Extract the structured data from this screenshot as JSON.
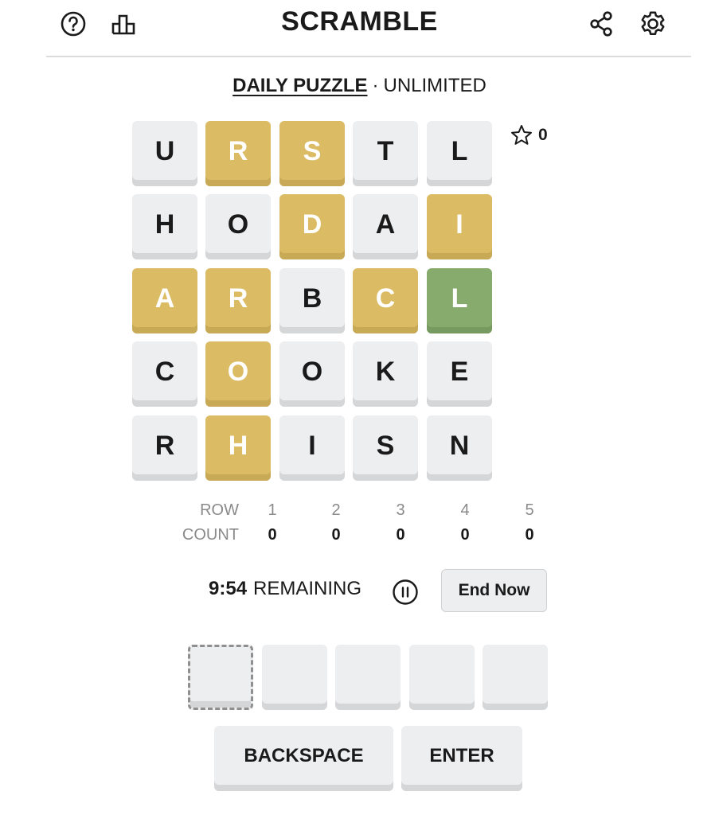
{
  "header": {
    "title": "SCRAMBLE",
    "icons": [
      "help-icon",
      "stats-icon",
      "share-icon",
      "settings-icon"
    ]
  },
  "mode": {
    "active": "DAILY PUZZLE",
    "separator": "·",
    "inactive": "UNLIMITED"
  },
  "score": {
    "icon": "star-icon",
    "value": "0"
  },
  "colors": {
    "gray": "#edeef0",
    "yellow": "#dbbb64",
    "green": "#86ab6d",
    "text": "#1a1a1a"
  },
  "grid": [
    [
      {
        "l": "U",
        "s": "gray"
      },
      {
        "l": "R",
        "s": "yellow"
      },
      {
        "l": "S",
        "s": "yellow"
      },
      {
        "l": "T",
        "s": "gray"
      },
      {
        "l": "L",
        "s": "gray"
      }
    ],
    [
      {
        "l": "H",
        "s": "gray"
      },
      {
        "l": "O",
        "s": "gray"
      },
      {
        "l": "D",
        "s": "yellow"
      },
      {
        "l": "A",
        "s": "gray"
      },
      {
        "l": "I",
        "s": "yellow"
      }
    ],
    [
      {
        "l": "A",
        "s": "yellow"
      },
      {
        "l": "R",
        "s": "yellow"
      },
      {
        "l": "B",
        "s": "gray"
      },
      {
        "l": "C",
        "s": "yellow"
      },
      {
        "l": "L",
        "s": "green"
      }
    ],
    [
      {
        "l": "C",
        "s": "gray"
      },
      {
        "l": "O",
        "s": "yellow"
      },
      {
        "l": "O",
        "s": "gray"
      },
      {
        "l": "K",
        "s": "gray"
      },
      {
        "l": "E",
        "s": "gray"
      }
    ],
    [
      {
        "l": "R",
        "s": "gray"
      },
      {
        "l": "H",
        "s": "yellow"
      },
      {
        "l": "I",
        "s": "gray"
      },
      {
        "l": "S",
        "s": "gray"
      },
      {
        "l": "N",
        "s": "gray"
      }
    ]
  ],
  "counts": {
    "row_label": "ROW",
    "count_label": "COUNT",
    "rows": [
      "1",
      "2",
      "3",
      "4",
      "5"
    ],
    "values": [
      "0",
      "0",
      "0",
      "0",
      "0"
    ]
  },
  "timer": {
    "time": "9:54",
    "label": "REMAINING",
    "pause_icon": "pause-icon",
    "end_label": "End Now"
  },
  "input": {
    "slots": [
      "",
      "",
      "",
      "",
      ""
    ],
    "current_index": 0
  },
  "keys": {
    "backspace": "BACKSPACE",
    "enter": "ENTER"
  }
}
